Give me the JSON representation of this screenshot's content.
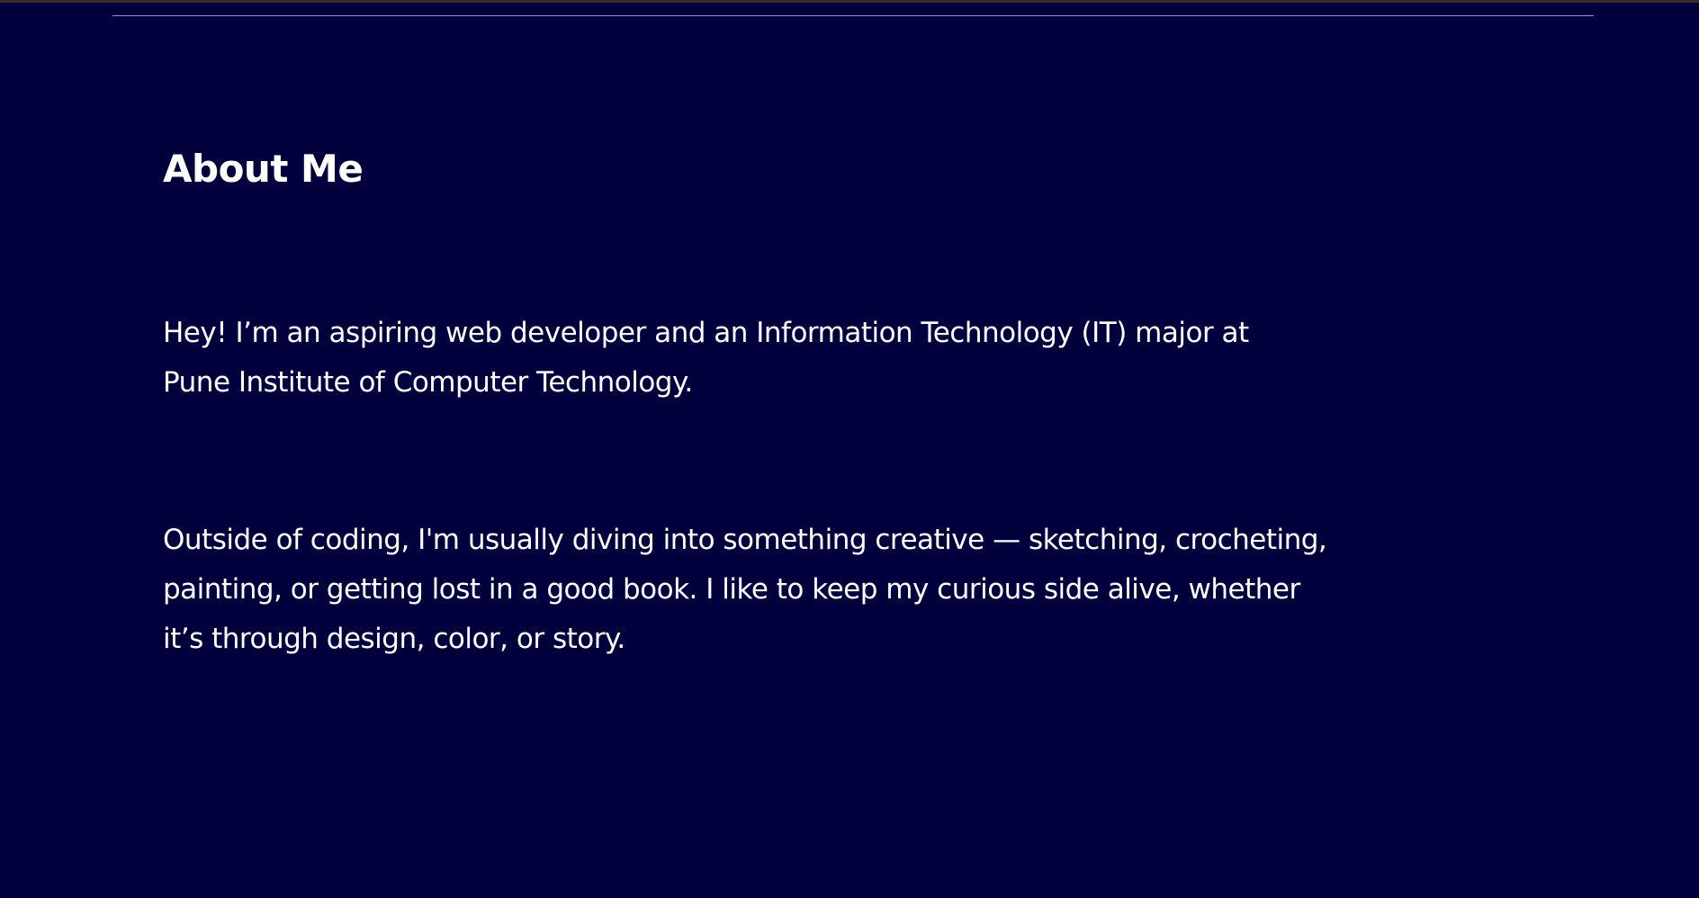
{
  "about": {
    "title": "About Me",
    "paragraphs": [
      {
        "lines": [
          "Hey! I’m an aspiring web developer and an Information Technology (IT) major at",
          "Pune Institute of Computer Technology."
        ]
      },
      {
        "lines": [
          "Outside of coding, I'm usually diving into something creative — sketching, crocheting,",
          "painting, or getting lost in a good book. I like to keep my curious side alive, whether",
          "it’s through design, color, or story."
        ]
      }
    ]
  },
  "colors": {
    "background": "#01003d",
    "text": "#ffffff",
    "divider": "#8d8fe6"
  }
}
